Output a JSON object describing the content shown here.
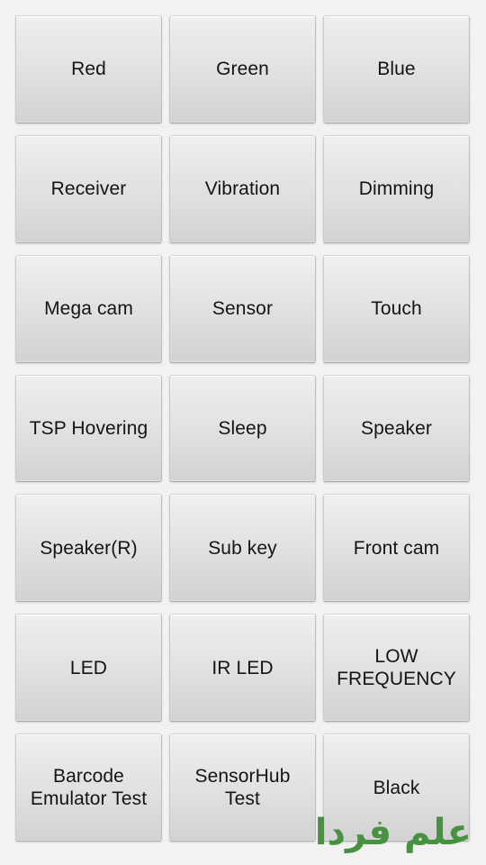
{
  "screen": {
    "name": "device-test-menu",
    "background_color": "#f2f2f2",
    "columns": 3,
    "rows": 7
  },
  "buttons": [
    {
      "label": "Red"
    },
    {
      "label": "Green"
    },
    {
      "label": "Blue"
    },
    {
      "label": "Receiver"
    },
    {
      "label": "Vibration"
    },
    {
      "label": "Dimming"
    },
    {
      "label": "Mega cam"
    },
    {
      "label": "Sensor"
    },
    {
      "label": "Touch"
    },
    {
      "label": "TSP Hovering"
    },
    {
      "label": "Sleep"
    },
    {
      "label": "Speaker"
    },
    {
      "label": "Speaker(R)"
    },
    {
      "label": "Sub key"
    },
    {
      "label": "Front cam"
    },
    {
      "label": "LED"
    },
    {
      "label": "IR LED"
    },
    {
      "label": "LOW\nFREQUENCY"
    },
    {
      "label": "Barcode\nEmulator Test"
    },
    {
      "label": "SensorHub\nTest"
    },
    {
      "label": "Black"
    }
  ],
  "watermark": {
    "text": "علم فردا",
    "color": "#479141"
  },
  "theme": {
    "button_text_color": "#141414",
    "button_border_color": "#bfbfbf",
    "button_gradient_top": "#f0f0f0",
    "button_gradient_bottom": "#d2d2d2"
  }
}
